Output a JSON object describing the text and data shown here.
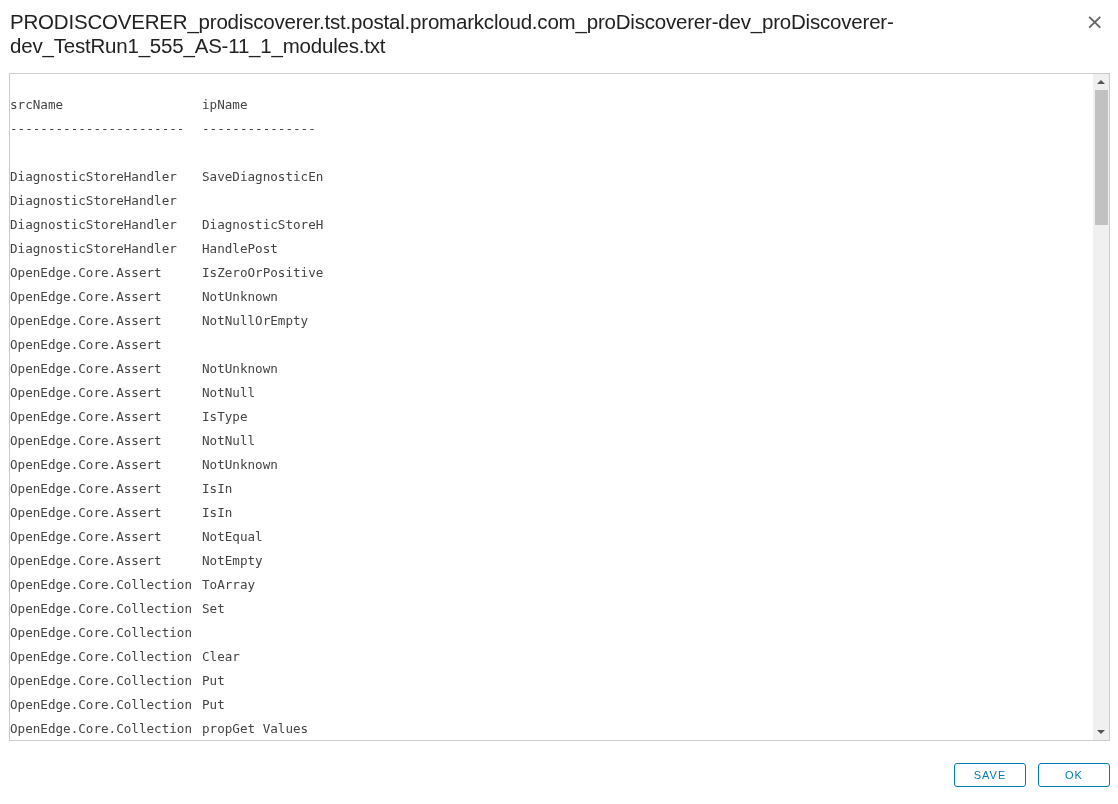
{
  "dialog": {
    "title": "PRODISCOVERER_prodiscoverer.tst.postal.promarkcloud.com_proDiscoverer-dev_proDiscoverer-dev_TestRun1_555_AS-11_1_modules.txt",
    "close_label": "×"
  },
  "file_content": {
    "header": {
      "src": "srcName",
      "ip": "ipName"
    },
    "separator": {
      "src": "-----------------------",
      "ip": "---------------"
    },
    "rows": [
      {
        "src": "DiagnosticStoreHandler",
        "ip": "SaveDiagnosticEn"
      },
      {
        "src": "DiagnosticStoreHandler"
      },
      {
        "src": "DiagnosticStoreHandler",
        "ip": "DiagnosticStoreH"
      },
      {
        "src": "DiagnosticStoreHandler",
        "ip": "HandlePost"
      },
      {
        "src": "OpenEdge.Core.Assert",
        "ip": "IsZeroOrPositive"
      },
      {
        "src": "OpenEdge.Core.Assert",
        "ip": "NotUnknown"
      },
      {
        "src": "OpenEdge.Core.Assert",
        "ip": "NotNullOrEmpty"
      },
      {
        "src": "OpenEdge.Core.Assert"
      },
      {
        "src": "OpenEdge.Core.Assert",
        "ip": "NotUnknown"
      },
      {
        "src": "OpenEdge.Core.Assert",
        "ip": "NotNull"
      },
      {
        "src": "OpenEdge.Core.Assert",
        "ip": "IsType"
      },
      {
        "src": "OpenEdge.Core.Assert",
        "ip": "NotNull"
      },
      {
        "src": "OpenEdge.Core.Assert",
        "ip": "NotUnknown"
      },
      {
        "src": "OpenEdge.Core.Assert",
        "ip": "IsIn"
      },
      {
        "src": "OpenEdge.Core.Assert",
        "ip": "IsIn"
      },
      {
        "src": "OpenEdge.Core.Assert",
        "ip": "NotEqual"
      },
      {
        "src": "OpenEdge.Core.Assert",
        "ip": "NotEmpty"
      },
      {
        "src": "OpenEdge.Core.Collection",
        "ip": "ToArray"
      },
      {
        "src": "OpenEdge.Core.Collection",
        "ip": "Set"
      },
      {
        "src": "OpenEdge.Core.Collection"
      },
      {
        "src": "OpenEdge.Core.Collection",
        "ip": "Clear"
      },
      {
        "src": "OpenEdge.Core.Collection",
        "ip": "Put"
      },
      {
        "src": "OpenEdge.Core.Collection",
        "ip": "Put"
      },
      {
        "src": "OpenEdge.Core.Collection",
        "ip": "propGet Values"
      }
    ]
  },
  "buttons": [
    {
      "label": "SAVE"
    },
    {
      "label": "OK"
    }
  ]
}
